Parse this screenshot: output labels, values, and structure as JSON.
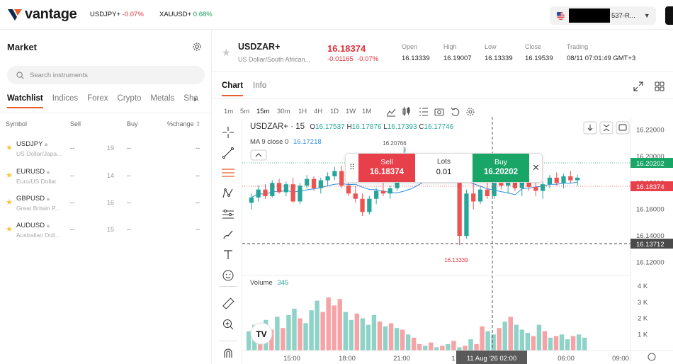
{
  "header": {
    "logo": "vantage",
    "tickers": [
      {
        "symbol": "USDJPY+",
        "change": "-0.07%",
        "dir": "neg"
      },
      {
        "symbol": "XAUUSD+",
        "change": "0.68%",
        "dir": "pos"
      }
    ],
    "account_suffix": "537-R..."
  },
  "market": {
    "title": "Market",
    "search_placeholder": "Search instruments",
    "tabs": [
      "Watchlist",
      "Indices",
      "Forex",
      "Crypto",
      "Metals",
      "Sha"
    ],
    "columns": {
      "symbol": "Symbol",
      "sell": "Sell",
      "buy": "Buy",
      "change": "%change"
    },
    "rows": [
      {
        "symbol": "USDJPY",
        "name": "US Dollar/Japa...",
        "sell": "--",
        "spread": "19",
        "buy": "--",
        "change": "--"
      },
      {
        "symbol": "EURUSD",
        "name": "Euro/US Dollar",
        "sell": "--",
        "spread": "14",
        "buy": "--",
        "change": "--"
      },
      {
        "symbol": "GBPUSD",
        "name": "Great Britain P...",
        "sell": "--",
        "spread": "16",
        "buy": "--",
        "change": "--"
      },
      {
        "symbol": "AUDUSD",
        "name": "Australian Doll...",
        "sell": "--",
        "spread": "15",
        "buy": "--",
        "change": "--"
      }
    ]
  },
  "instrument": {
    "symbol": "USDZAR+",
    "name": "US Dollar/South African...",
    "price": "16.18374",
    "change_abs": "-0.01165",
    "change_pct": "-0.07%",
    "stats": [
      {
        "label": "Open",
        "value": "16.13339"
      },
      {
        "label": "High",
        "value": "16.19007"
      },
      {
        "label": "Low",
        "value": "16.13339"
      },
      {
        "label": "Close",
        "value": "16.19539"
      },
      {
        "label": "Trading",
        "value": "08/11 07:01:49 GMT+3"
      }
    ]
  },
  "chart_tabs": [
    "Chart",
    "Info"
  ],
  "timeframes": [
    "1m",
    "5m",
    "15m",
    "30m",
    "1H",
    "4H",
    "1D",
    "1W",
    "1M"
  ],
  "active_timeframe": "15m",
  "legend": {
    "title": "USDZAR+ · 15",
    "o_label": "O",
    "o": "16.17537",
    "h_label": "H",
    "h": "16.17876",
    "l_label": "L",
    "l": "16.17393",
    "c_label": "C",
    "c": "16.17746",
    "ma_label": "MA 9 close 0",
    "ma": "16.17218",
    "volume_label": "Volume",
    "volume": "345"
  },
  "trade": {
    "sell_label": "Sell",
    "sell_price": "16.18374",
    "lots_label": "Lots",
    "lots": "0.01",
    "buy_label": "Buy",
    "buy_price": "16.20202"
  },
  "price_axis": [
    "16.22000",
    "16.20000",
    "16.18000",
    "16.16000",
    "16.14000",
    "16.12000"
  ],
  "price_tags": {
    "buy": "16.20202",
    "sell": "16.18374",
    "cross": "16.13712"
  },
  "annotations": {
    "high": "16.20766",
    "low": "16.13339"
  },
  "volume_axis": [
    "4 K",
    "3 K",
    "2 K",
    "1 K"
  ],
  "time_axis": [
    "15:00",
    "18:00",
    "21:00",
    "1",
    "02:00",
    "06:00",
    "09:00"
  ],
  "time_cursor": "11 Aug '26   02:00",
  "colors": {
    "up": "#26a69a",
    "down": "#ef5350",
    "accent": "#e85d2b",
    "sell": "#e8404a",
    "buy": "#18a566"
  },
  "chart_data": {
    "type": "candlestick",
    "interval": "15m",
    "ylim": [
      16.11,
      16.23
    ],
    "candles": [
      [
        16.165,
        16.172,
        16.16,
        16.169
      ],
      [
        16.169,
        16.178,
        16.166,
        16.175
      ],
      [
        16.175,
        16.179,
        16.168,
        16.17
      ],
      [
        16.17,
        16.182,
        16.169,
        16.18
      ],
      [
        16.18,
        16.183,
        16.172,
        16.173
      ],
      [
        16.173,
        16.181,
        16.17,
        16.179
      ],
      [
        16.179,
        16.184,
        16.165,
        16.166
      ],
      [
        16.166,
        16.18,
        16.164,
        16.178
      ],
      [
        16.178,
        16.186,
        16.176,
        16.183
      ],
      [
        16.183,
        16.185,
        16.174,
        16.176
      ],
      [
        16.176,
        16.184,
        16.172,
        16.182
      ],
      [
        16.182,
        16.188,
        16.178,
        16.185
      ],
      [
        16.185,
        16.192,
        16.182,
        16.189
      ],
      [
        16.189,
        16.193,
        16.176,
        16.178
      ],
      [
        16.178,
        16.182,
        16.17,
        16.172
      ],
      [
        16.172,
        16.178,
        16.165,
        16.168
      ],
      [
        16.168,
        16.172,
        16.155,
        16.158
      ],
      [
        16.158,
        16.17,
        16.156,
        16.168
      ],
      [
        16.168,
        16.176,
        16.164,
        16.174
      ],
      [
        16.174,
        16.18,
        16.17,
        16.172
      ],
      [
        16.172,
        16.178,
        16.168,
        16.176
      ],
      [
        16.176,
        16.188,
        16.174,
        16.186
      ],
      [
        16.186,
        16.207,
        16.184,
        16.19
      ],
      [
        16.19,
        16.196,
        16.186,
        16.188
      ],
      [
        16.188,
        16.194,
        16.184,
        16.192
      ],
      [
        16.192,
        16.195,
        16.185,
        16.187
      ],
      [
        16.187,
        16.192,
        16.182,
        16.19
      ],
      [
        16.19,
        16.194,
        16.186,
        16.188
      ],
      [
        16.188,
        16.193,
        16.184,
        16.191
      ],
      [
        16.191,
        16.194,
        16.187,
        16.189
      ],
      [
        16.18,
        16.186,
        16.133,
        16.14
      ],
      [
        16.14,
        16.175,
        16.138,
        16.172
      ],
      [
        16.172,
        16.18,
        16.16,
        16.166
      ],
      [
        16.166,
        16.178,
        16.164,
        16.175
      ],
      [
        16.175,
        16.183,
        16.168,
        16.17
      ],
      [
        16.17,
        16.182,
        16.168,
        16.18
      ],
      [
        16.18,
        16.186,
        16.175,
        16.178
      ],
      [
        16.178,
        16.184,
        16.172,
        16.182
      ],
      [
        16.182,
        16.185,
        16.174,
        16.176
      ],
      [
        16.176,
        16.183,
        16.17,
        16.181
      ],
      [
        16.181,
        16.184,
        16.174,
        16.177
      ],
      [
        16.177,
        16.182,
        16.17,
        16.174
      ],
      [
        16.174,
        16.181,
        16.168,
        16.179
      ],
      [
        16.179,
        16.186,
        16.176,
        16.184
      ],
      [
        16.184,
        16.188,
        16.178,
        16.18
      ],
      [
        16.18,
        16.187,
        16.176,
        16.185
      ],
      [
        16.185,
        16.189,
        16.18,
        16.182
      ],
      [
        16.182,
        16.186,
        16.178,
        16.184
      ]
    ],
    "volumes": [
      1.2,
      1.6,
      1.1,
      1.9,
      1.3,
      2.1,
      1.4,
      2.2,
      2.6,
      2.0,
      1.7,
      2.5,
      3.1,
      2.4,
      3.3,
      2.8,
      3.2,
      2.4,
      1.9,
      2.3,
      2.0,
      1.6,
      2.2,
      1.8,
      1.5,
      1.7,
      1.4,
      1.3,
      1.0,
      0.8,
      0.4,
      0.3,
      0.5,
      0.2,
      0.3,
      0.4,
      0.6,
      0.2,
      0.3,
      0.7,
      0.4,
      1.5,
      1.2,
      1.0,
      1.4,
      1.8,
      2.1,
      1.6,
      1.3,
      1.1,
      0.9,
      1.6,
      1.2,
      0.8,
      0.9,
      1.0,
      0.7,
      0.9,
      1.0,
      0.8
    ]
  }
}
